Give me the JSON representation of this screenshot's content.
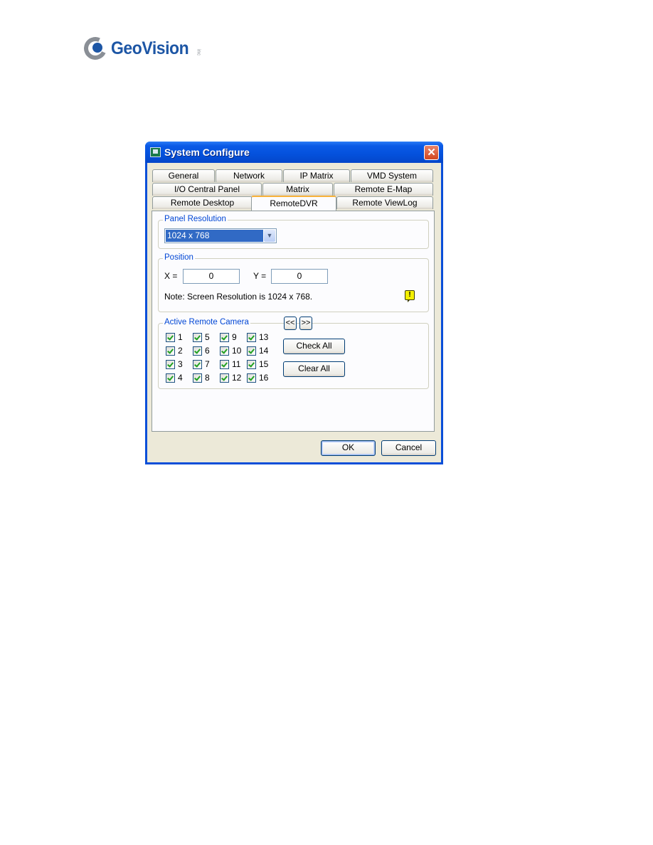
{
  "logo": {
    "brand": "GeoVision",
    "suffix": "inc"
  },
  "window": {
    "title": "System Configure",
    "close_glyph": "✕"
  },
  "tabs": {
    "row1": [
      "General",
      "Network",
      "IP Matrix",
      "VMD System"
    ],
    "row2": [
      "I/O Central Panel",
      "Matrix",
      "Remote E-Map"
    ],
    "row3": [
      "Remote Desktop",
      "RemoteDVR",
      "Remote ViewLog"
    ],
    "active": "RemoteDVR"
  },
  "panel_resolution": {
    "label": "Panel Resolution",
    "selected": "1024 x 768",
    "arrow_glyph": "▼"
  },
  "position": {
    "label": "Position",
    "x_label": "X =",
    "x_value": "0",
    "y_label": "Y =",
    "y_value": "0",
    "note": "Note: Screen Resolution is 1024 x 768.",
    "warn_glyph": "!"
  },
  "active_remote_camera": {
    "label": "Active Remote Camera",
    "prev_label": "<<",
    "next_label": ">>",
    "check_all_label": "Check All",
    "clear_all_label": "Clear All",
    "cameras": [
      {
        "label": "1",
        "checked": true
      },
      {
        "label": "2",
        "checked": true
      },
      {
        "label": "3",
        "checked": true
      },
      {
        "label": "4",
        "checked": true
      },
      {
        "label": "5",
        "checked": true
      },
      {
        "label": "6",
        "checked": true
      },
      {
        "label": "7",
        "checked": true
      },
      {
        "label": "8",
        "checked": true
      },
      {
        "label": "9",
        "checked": true
      },
      {
        "label": "10",
        "checked": true
      },
      {
        "label": "11",
        "checked": true
      },
      {
        "label": "12",
        "checked": true
      },
      {
        "label": "13",
        "checked": true
      },
      {
        "label": "14",
        "checked": true
      },
      {
        "label": "15",
        "checked": true
      },
      {
        "label": "16",
        "checked": true
      }
    ]
  },
  "footer": {
    "ok_label": "OK",
    "cancel_label": "Cancel"
  }
}
